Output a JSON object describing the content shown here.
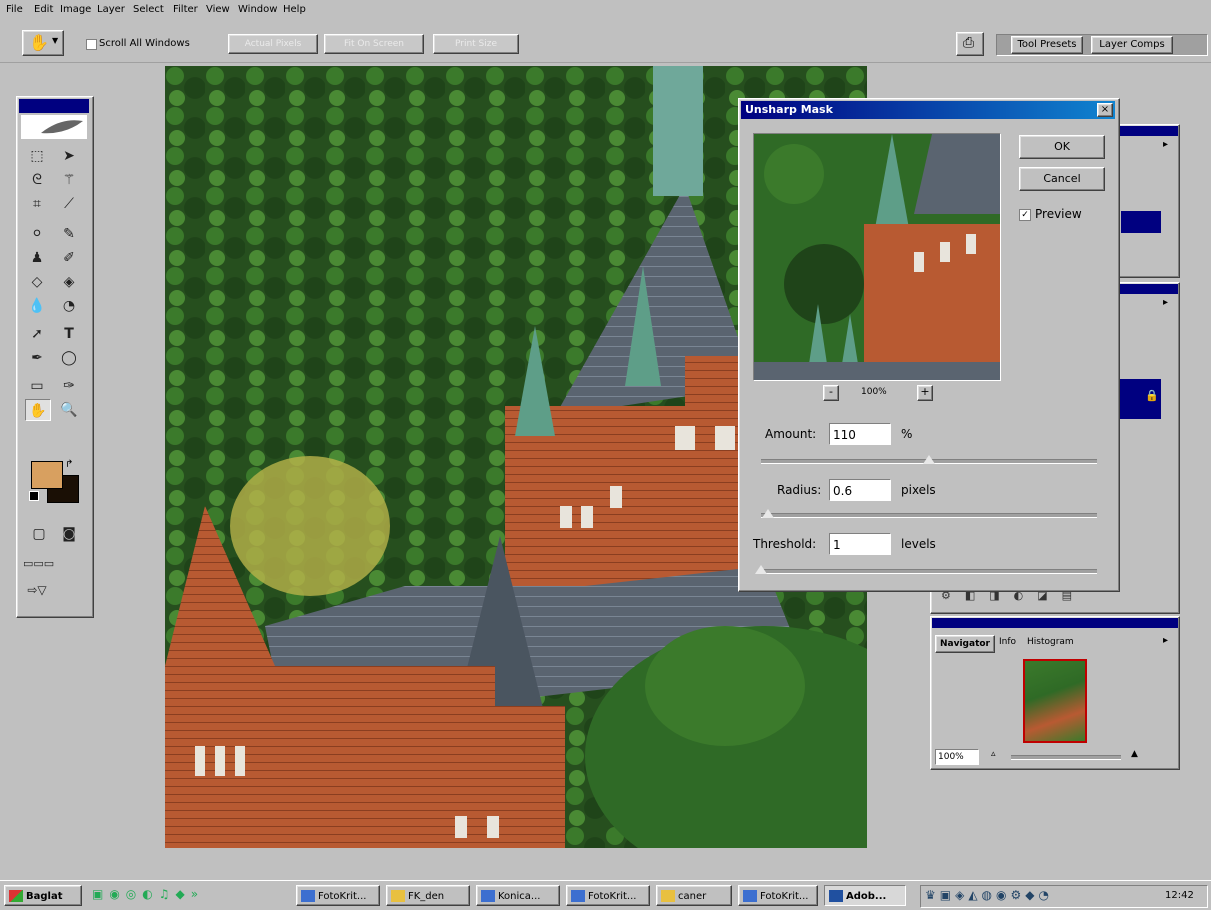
{
  "menu": [
    "File",
    "Edit",
    "Image",
    "Layer",
    "Select",
    "Filter",
    "View",
    "Window",
    "Help"
  ],
  "options_bar": {
    "scroll_all_label": "Scroll All Windows",
    "dim_buttons": [
      "Actual Pixels",
      "Fit On Screen",
      "Print Size"
    ],
    "tab_tool_presets": "Tool Presets",
    "tab_layer_comps": "Layer Comps"
  },
  "dialog": {
    "title": "Unsharp Mask",
    "ok": "OK",
    "cancel": "Cancel",
    "preview_label": "Preview",
    "preview_checked": true,
    "zoom": "100%",
    "zoom_out": "-",
    "zoom_in": "+",
    "close": "×",
    "amount": {
      "label": "Amount:",
      "value": "110",
      "unit": "%",
      "slider": 0.5
    },
    "radius": {
      "label": "Radius:",
      "value": "0.6",
      "unit": "pixels",
      "slider": 0.02
    },
    "threshold": {
      "label": "Threshold:",
      "value": "1",
      "unit": "levels",
      "slider": 0.0
    }
  },
  "navigator": {
    "tabs": [
      "Navigator",
      "Info",
      "Histogram"
    ],
    "zoom": "100%"
  },
  "taskbar": {
    "start_label": "Baglat",
    "tasks": [
      "FotoKrit...",
      "FK_den",
      "Konica...",
      "FotoKrit...",
      "caner",
      "FotoKrit...",
      "Adob..."
    ],
    "time": "12:42"
  },
  "colors": {
    "title_active": "#000080",
    "foreground_swatch": "#d8a060",
    "background_swatch": "#1a0f05"
  }
}
